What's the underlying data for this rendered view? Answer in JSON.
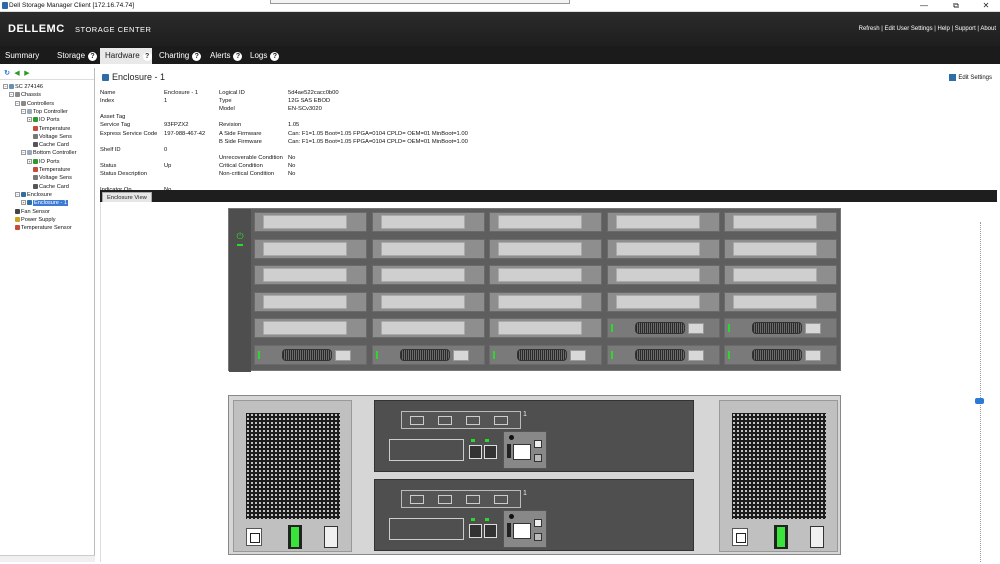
{
  "window": {
    "title": "Dell Storage Manager Client [172.16.74.74]",
    "minimize": "—",
    "maximize": "⧉",
    "close": "✕"
  },
  "header": {
    "brand": "DELLEMC",
    "product": "STORAGE CENTER",
    "links": [
      "Refresh",
      "Edit User Settings",
      "Help",
      "Support",
      "About"
    ],
    "link_sep": " | "
  },
  "tabs": [
    {
      "label": "Summary",
      "active": false
    },
    {
      "label": "Storage",
      "active": false
    },
    {
      "label": "Hardware",
      "active": true
    },
    {
      "label": "Charting",
      "active": false
    },
    {
      "label": "Alerts",
      "active": false
    },
    {
      "label": "Logs",
      "active": false
    }
  ],
  "tab_help": "?",
  "tree": [
    {
      "label": "SC 274146",
      "depth": 0,
      "exp": "−",
      "icon": "storage-center-icon"
    },
    {
      "label": "Chassis",
      "depth": 1,
      "exp": "−",
      "icon": "chassis-icon"
    },
    {
      "label": "Controllers",
      "depth": 2,
      "exp": "−",
      "icon": "controllers-icon"
    },
    {
      "label": "Top Controller",
      "depth": 3,
      "exp": "−",
      "icon": "controller-icon"
    },
    {
      "label": "IO Ports",
      "depth": 4,
      "exp": "+",
      "icon": "io-ports-icon"
    },
    {
      "label": "Temperature",
      "depth": 5,
      "icon": "temperature-icon"
    },
    {
      "label": "Voltage Sens",
      "depth": 5,
      "icon": "voltage-icon"
    },
    {
      "label": "Cache Card",
      "depth": 5,
      "icon": "cache-card-icon"
    },
    {
      "label": "Bottom Controller",
      "depth": 3,
      "exp": "−",
      "icon": "controller-icon"
    },
    {
      "label": "IO Ports",
      "depth": 4,
      "exp": "+",
      "icon": "io-ports-icon"
    },
    {
      "label": "Temperature",
      "depth": 5,
      "icon": "temperature-icon"
    },
    {
      "label": "Voltage Sens",
      "depth": 5,
      "icon": "voltage-icon"
    },
    {
      "label": "Cache Card",
      "depth": 5,
      "icon": "cache-card-icon"
    },
    {
      "label": "Enclosure",
      "depth": 2,
      "exp": "−",
      "icon": "enclosure-icon"
    },
    {
      "label": "Enclosure - 1",
      "depth": 3,
      "exp": "+",
      "icon": "enclosure-icon",
      "selected": true
    },
    {
      "label": "Fan Sensor",
      "depth": 2,
      "icon": "fan-icon"
    },
    {
      "label": "Power Supply",
      "depth": 2,
      "icon": "power-supply-icon"
    },
    {
      "label": "Temperature Sensor",
      "depth": 2,
      "icon": "temperature-icon"
    }
  ],
  "enclosure": {
    "title": "Enclosure - 1",
    "edit_settings": "Edit Settings",
    "left_props": [
      {
        "k": "Name",
        "v": "Enclosure - 1"
      },
      {
        "k": "Index",
        "v": "1"
      },
      {
        "k": "",
        "v": ""
      },
      {
        "k": "Asset Tag",
        "v": ""
      },
      {
        "k": "Service Tag",
        "v": "93FPZX2"
      },
      {
        "k": "Express Service Code",
        "v": "197-988-467-42"
      },
      {
        "k": "",
        "v": ""
      },
      {
        "k": "Shelf ID",
        "v": "0"
      },
      {
        "k": "",
        "v": ""
      },
      {
        "k": "Status",
        "v": "Up"
      },
      {
        "k": "Status Description",
        "v": ""
      },
      {
        "k": "",
        "v": ""
      },
      {
        "k": "Indicator On",
        "v": "No"
      }
    ],
    "right_props": [
      {
        "k": "Logical ID",
        "v": "5d4ae522cacc0b00"
      },
      {
        "k": "Type",
        "v": "12G SAS EBOD"
      },
      {
        "k": "Model",
        "v": "EN-SCv3020"
      },
      {
        "k": "",
        "v": ""
      },
      {
        "k": "Revision",
        "v": "1.05"
      },
      {
        "k": "A Side Firmware",
        "v": "Can: F1=1.05 Boot=1.05 FPGA=0104 CPLD= OEM=01 MinBoot=1.00"
      },
      {
        "k": "B Side Firmware",
        "v": "Can: F1=1.05 Boot=1.05 FPGA=0104 CPLD= OEM=01 MinBoot=1.00"
      },
      {
        "k": "",
        "v": ""
      },
      {
        "k": "Unrecoverable Condition",
        "v": "No"
      },
      {
        "k": "Critical Condition",
        "v": "No"
      },
      {
        "k": "Non-critical Condition",
        "v": "No"
      }
    ],
    "view_tab": "Enclosure View",
    "controller_num": "1",
    "controller_label": "⟵ ⟶ ●⊙"
  },
  "icons": {
    "refresh": "↻",
    "back": "◀",
    "forward": "▶",
    "power": "⏻"
  },
  "colors": {
    "accent": "#3b7bd5",
    "led_green": "#2bd92b",
    "header_bg": "#1e1e1e"
  },
  "drive_rows": 6,
  "drive_cols": 5
}
